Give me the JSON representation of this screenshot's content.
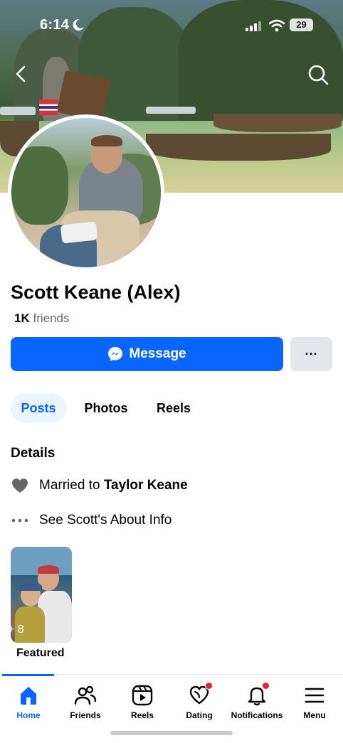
{
  "status_bar": {
    "time": "6:14",
    "battery": "29"
  },
  "profile": {
    "name": "Scott Keane (Alex)",
    "friends_count": "1K",
    "friends_label": "friends"
  },
  "actions": {
    "message_label": "Message",
    "more_label": "···"
  },
  "tabs": [
    {
      "label": "Posts",
      "active": true
    },
    {
      "label": "Photos",
      "active": false
    },
    {
      "label": "Reels",
      "active": false
    }
  ],
  "details": {
    "title": "Details",
    "married_prefix": "Married to",
    "married_name": "Taylor Keane",
    "about_label": "See Scott's About Info"
  },
  "featured": {
    "count": "+ 8",
    "label": "Featured"
  },
  "nav": [
    {
      "label": "Home",
      "icon": "home-icon",
      "active": true,
      "badge": false
    },
    {
      "label": "Friends",
      "icon": "friends-icon",
      "active": false,
      "badge": false
    },
    {
      "label": "Reels",
      "icon": "reels-icon",
      "active": false,
      "badge": false
    },
    {
      "label": "Dating",
      "icon": "dating-icon",
      "active": false,
      "badge": true
    },
    {
      "label": "Notifications",
      "icon": "bell-icon",
      "active": false,
      "badge": true
    },
    {
      "label": "Menu",
      "icon": "menu-icon",
      "active": false,
      "badge": false
    }
  ],
  "colors": {
    "accent": "#0866ff",
    "badge": "#e41e3f",
    "tab_bg": "#ebf5ff",
    "secondary_btn": "#e4e6eb"
  }
}
